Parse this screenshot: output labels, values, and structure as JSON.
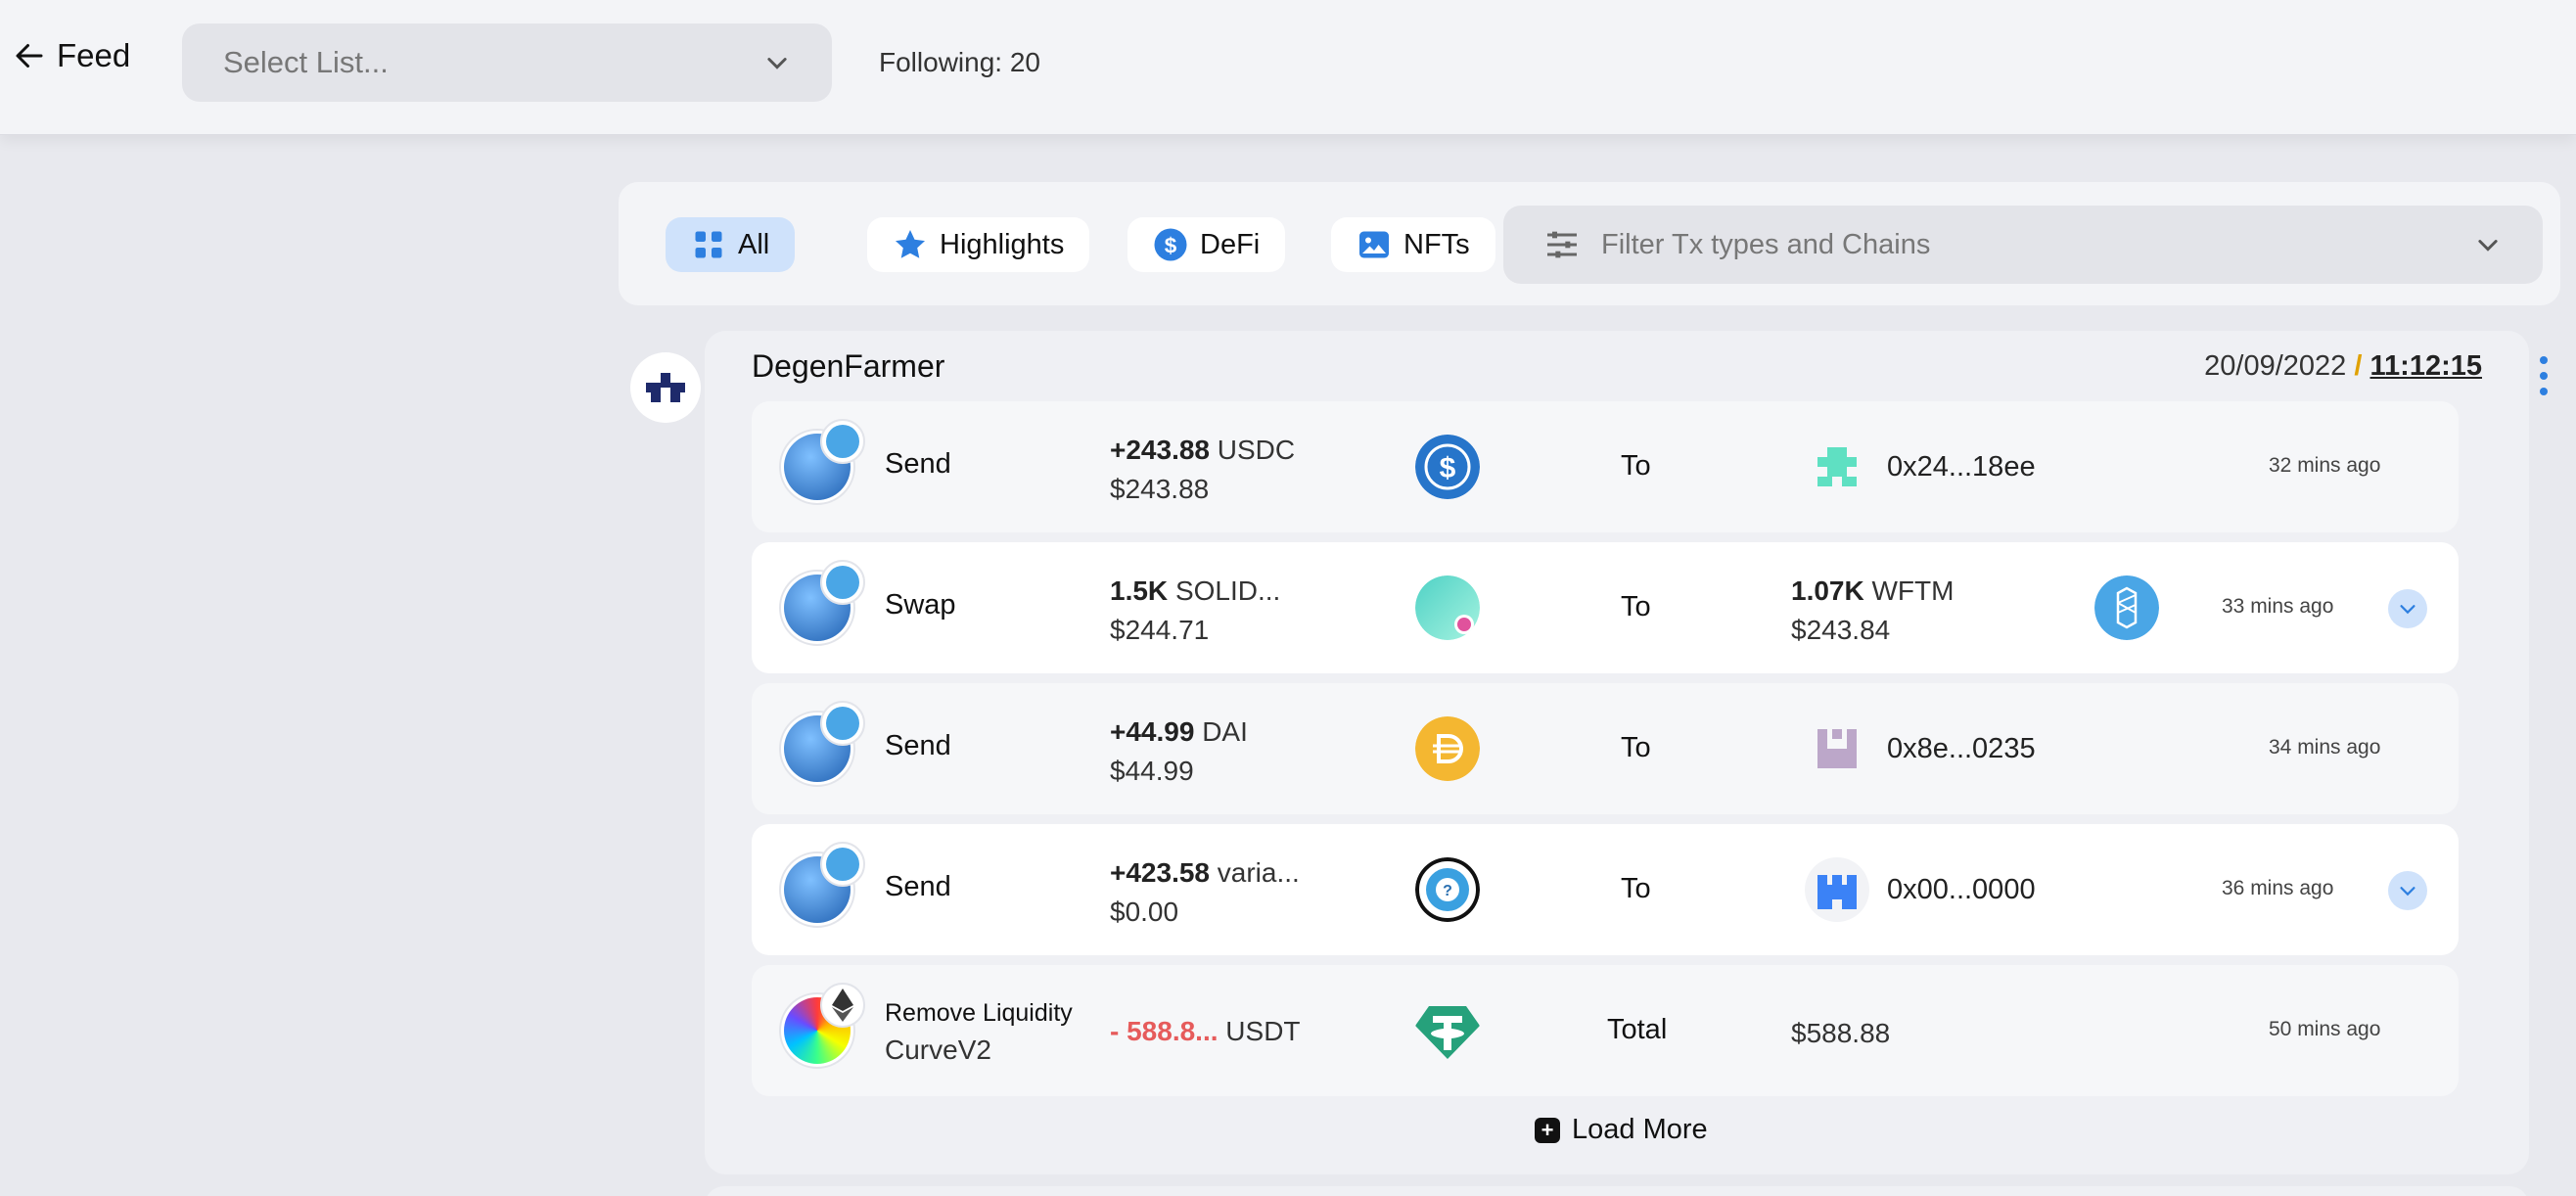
{
  "header": {
    "back_label": "Feed",
    "select_placeholder": "Select List...",
    "following": "Following: 20"
  },
  "filters": {
    "all": "All",
    "highlights": "Highlights",
    "defi": "DeFi",
    "nfts": "NFTs",
    "tx_filter_placeholder": "Filter Tx types and Chains"
  },
  "feed": {
    "username": "DegenFarmer",
    "date": "20/09/2022",
    "slash": "/",
    "time": "11:12:15",
    "rows": [
      {
        "action": "Send",
        "amount": "+243.88",
        "token": "USDC",
        "usd": "$243.88",
        "to": "To",
        "dest": "0x24...18ee",
        "ago": "32 mins ago"
      },
      {
        "action": "Swap",
        "amount": "1.5K",
        "token": "SOLID...",
        "usd": "$244.71",
        "to": "To",
        "recv_amount": "1.07K",
        "recv_token": "WFTM",
        "recv_usd": "$243.84",
        "ago": "33 mins ago"
      },
      {
        "action": "Send",
        "amount": "+44.99",
        "token": "DAI",
        "usd": "$44.99",
        "to": "To",
        "dest": "0x8e...0235",
        "ago": "34 mins ago"
      },
      {
        "action": "Send",
        "amount": "+423.58",
        "token": "varia...",
        "usd": "$0.00",
        "to": "To",
        "dest": "0x00...0000",
        "ago": "36 mins ago"
      },
      {
        "action": "Remove Liquidity",
        "protocol": "CurveV2",
        "amount": "- 588.8...",
        "token": "USDT",
        "total_label": "Total",
        "total": "$588.88",
        "ago": "50 mins ago"
      }
    ],
    "load_more": "Load More"
  },
  "colors": {
    "accent": "#2d7fe0",
    "active_pill": "#cfe2fb",
    "negative": "#e65b5b",
    "usdc": "#2775ca",
    "dai": "#f4b731",
    "usdt": "#26a17b",
    "wftm": "#4aa6e6"
  }
}
